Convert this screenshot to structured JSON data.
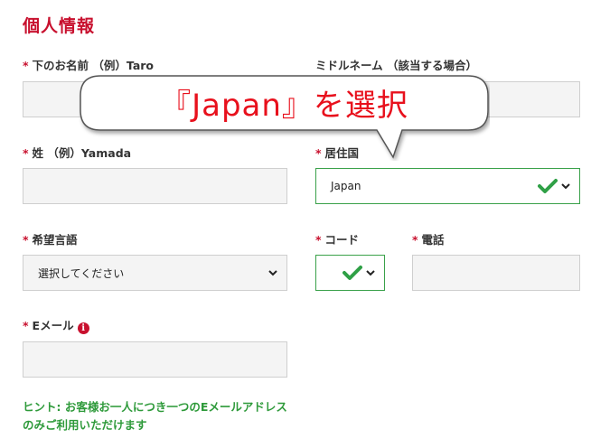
{
  "section": {
    "title": "個人情報"
  },
  "required_mark": "*",
  "fields": {
    "first_name": {
      "label": "下のお名前 （例）Taro",
      "value": ""
    },
    "middle_name": {
      "label": "ミドルネーム （該当する場合）",
      "value": ""
    },
    "last_name": {
      "label": "姓 （例）Yamada",
      "value": ""
    },
    "country": {
      "label": "居住国",
      "value": "Japan"
    },
    "language": {
      "label": "希望言語",
      "value": "選択してください"
    },
    "code": {
      "label": "コード",
      "value": ""
    },
    "phone": {
      "label": "電話",
      "value": ""
    },
    "email": {
      "label": "Eメール",
      "info_icon": "info-icon",
      "value": ""
    }
  },
  "hint": {
    "text": "ヒント: お客様お一人につき一つのEメールアドレスのみご利用いただけます"
  },
  "callout": {
    "text": "『Japan』を選択"
  },
  "colors": {
    "accent_red": "#c8102e",
    "valid_green": "#3aa14a",
    "hint_green": "#2e9a3a",
    "callout_red": "#e8101c"
  }
}
